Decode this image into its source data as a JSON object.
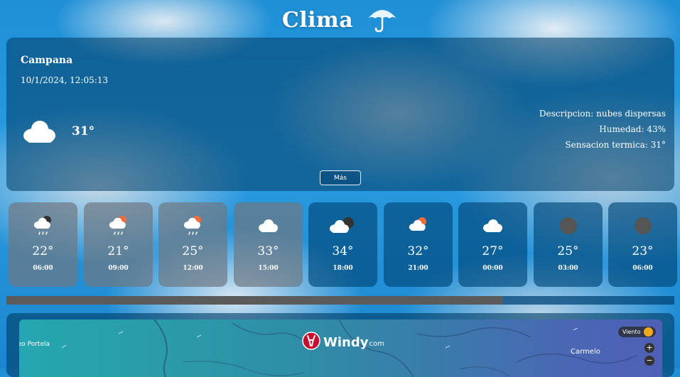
{
  "app": {
    "title": "Clima",
    "title_icon": "umbrella-icon"
  },
  "current": {
    "city": "Campana",
    "datetime": "10/1/2024, 12:05:13",
    "icon": "cloud-icon",
    "temp": "31°",
    "description": "Descripcion: nubes dispersas",
    "humidity": "Humedad: 43%",
    "feels_like": "Sensacion termica: 31°",
    "more_button": "Más"
  },
  "forecast": [
    {
      "temp": "22°",
      "time": "06:00",
      "icon": "night-cloud-rain-icon",
      "style": "gray"
    },
    {
      "temp": "21°",
      "time": "09:00",
      "icon": "sun-cloud-rain-icon",
      "style": "gray"
    },
    {
      "temp": "25°",
      "time": "12:00",
      "icon": "sun-cloud-rain-icon",
      "style": "gray"
    },
    {
      "temp": "33°",
      "time": "15:00",
      "icon": "cloud-icon",
      "style": "gray"
    },
    {
      "temp": "34°",
      "time": "18:00",
      "icon": "night-cloud-icon",
      "style": "blue"
    },
    {
      "temp": "32°",
      "time": "21:00",
      "icon": "sun-cloud-icon",
      "style": "blue"
    },
    {
      "temp": "27°",
      "time": "00:00",
      "icon": "cloud-icon",
      "style": "blue"
    },
    {
      "temp": "25°",
      "time": "03:00",
      "icon": "moon-icon",
      "style": "blue"
    },
    {
      "temp": "23°",
      "time": "06:00",
      "icon": "moon-icon",
      "style": "blue"
    }
  ],
  "map": {
    "brand": "Windy",
    "brand_suffix": "com",
    "place_left": "neo Portela",
    "place_right": "Carmelo",
    "layer_button": "Viento",
    "zoom_in": "+",
    "zoom_out": "−"
  },
  "colors": {
    "sun": "#f26b3a",
    "moon": "#555555",
    "windy_red": "#c8102e",
    "viento_icon": "#f0a81c"
  }
}
